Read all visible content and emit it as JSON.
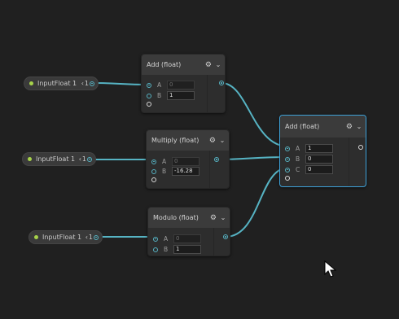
{
  "colors": {
    "wire": "#56b3c3",
    "selected": "#3ea2d9",
    "canvas": "#202020",
    "float_dot": "#a7d34a"
  },
  "inputs": [
    {
      "label": "InputFloat 1",
      "tail": "1"
    },
    {
      "label": "InputFloat 1",
      "tail": "1"
    },
    {
      "label": "InputFloat 1",
      "tail": "1"
    }
  ],
  "add_node": {
    "title": "Add (float)",
    "rows": [
      {
        "label": "A",
        "value": "0"
      },
      {
        "label": "B",
        "value": "1"
      }
    ]
  },
  "multiply_node": {
    "title": "Multiply (float)",
    "rows": [
      {
        "label": "A",
        "value": "0"
      },
      {
        "label": "B",
        "value": "-16.28"
      }
    ]
  },
  "modulo_node": {
    "title": "Modulo (float)",
    "rows": [
      {
        "label": "A",
        "value": "0"
      },
      {
        "label": "B",
        "value": "1"
      }
    ]
  },
  "add_node_2": {
    "title": "Add (float)",
    "rows": [
      {
        "label": "A",
        "value": "1"
      },
      {
        "label": "B",
        "value": "0"
      },
      {
        "label": "C",
        "value": "0"
      }
    ]
  },
  "icons": {
    "gear": "gear-icon",
    "chevron": "chevron-down-icon",
    "cursor": "mouse-cursor-icon"
  }
}
